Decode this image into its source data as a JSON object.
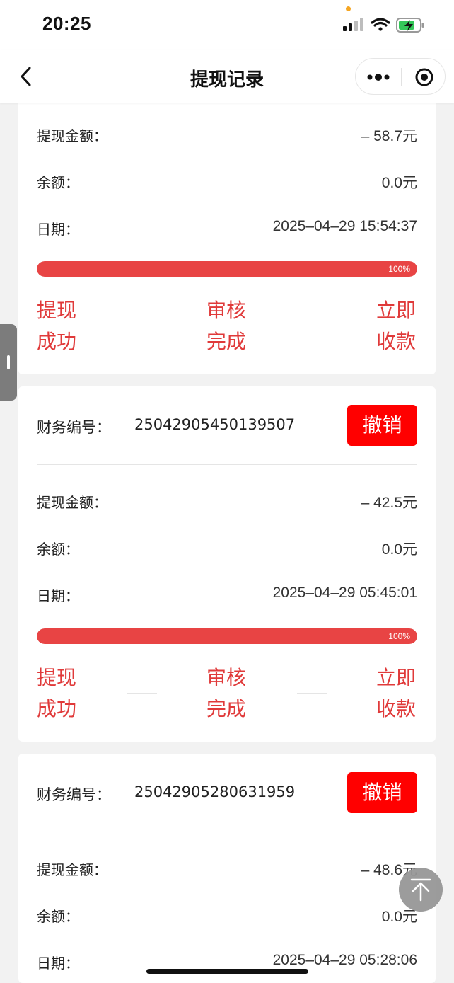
{
  "status_bar": {
    "time": "20:25"
  },
  "nav": {
    "title": "提现记录"
  },
  "labels": {
    "finance_no": "财务编号：",
    "amount": "提现金额：",
    "balance": "余额：",
    "date": "日期：",
    "cancel": "撤销"
  },
  "steps": [
    "提现成功",
    "审核完成",
    "立即收款"
  ],
  "records": [
    {
      "amount": "– 58.7元",
      "balance": "0.0元",
      "date": "2025–04–29 15:54:37",
      "progress": 100,
      "progress_text": "100%"
    },
    {
      "finance_no": "25042905450139507",
      "amount": "– 42.5元",
      "balance": "0.0元",
      "date": "2025–04–29 05:45:01",
      "progress": 100,
      "progress_text": "100%"
    },
    {
      "finance_no": "25042905280631959",
      "amount": "– 48.6元",
      "balance": "0.0元",
      "date": "2025–04–29 05:28:06"
    }
  ],
  "colors": {
    "accent_red": "#e84444",
    "cancel_red": "#ff0000",
    "step_red": "#e03a3a"
  }
}
